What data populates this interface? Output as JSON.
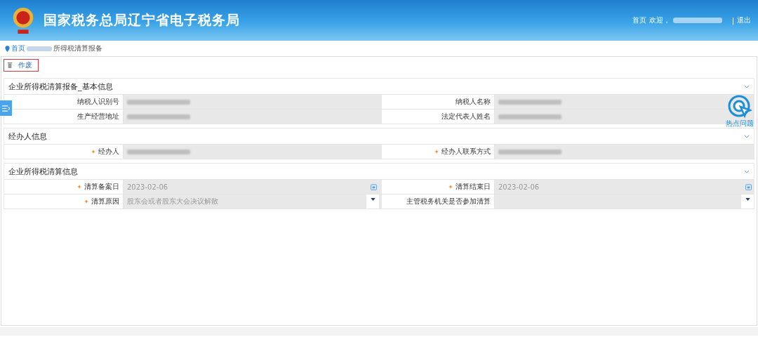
{
  "header": {
    "title": "国家税务总局辽宁省电子税务局",
    "home_link": "首页",
    "welcome": "欢迎，",
    "user_blurred": true,
    "separator": "|",
    "logout": "退出"
  },
  "breadcrumb": {
    "home": "首页",
    "middle_blurred": true,
    "current": "所得税清算报备"
  },
  "toolbar": {
    "void_button": "作废"
  },
  "side_tab": {
    "kind": "menu"
  },
  "help": {
    "label": "热点问题"
  },
  "sections": [
    {
      "title": "企业所得税清算报备_基本信息",
      "expanded": true,
      "fields": [
        {
          "label": "纳税人识别号",
          "required": false,
          "kind": "text",
          "blurred": true
        },
        {
          "label": "纳税人名称",
          "required": false,
          "kind": "text",
          "blurred": true
        },
        {
          "label": "生产经营地址",
          "required": false,
          "kind": "text",
          "blurred": true
        },
        {
          "label": "法定代表人姓名",
          "required": false,
          "kind": "text",
          "blurred": true
        }
      ]
    },
    {
      "title": "经办人信息",
      "expanded": true,
      "fields": [
        {
          "label": "经办人",
          "required": true,
          "kind": "text",
          "blurred": true
        },
        {
          "label": "经办人联系方式",
          "required": true,
          "kind": "text",
          "blurred": true
        }
      ]
    },
    {
      "title": "企业所得税清算信息",
      "expanded": true,
      "fields": [
        {
          "label": "清算备案日",
          "required": true,
          "kind": "date",
          "value": "2023-02-06"
        },
        {
          "label": "清算结束日",
          "required": true,
          "kind": "date",
          "value": "2023-02-06"
        },
        {
          "label": "清算原因",
          "required": true,
          "kind": "select",
          "value": "股东会或者股东大会决议解散"
        },
        {
          "label": "主管税务机关是否参加清算",
          "required": false,
          "kind": "select"
        }
      ]
    }
  ]
}
